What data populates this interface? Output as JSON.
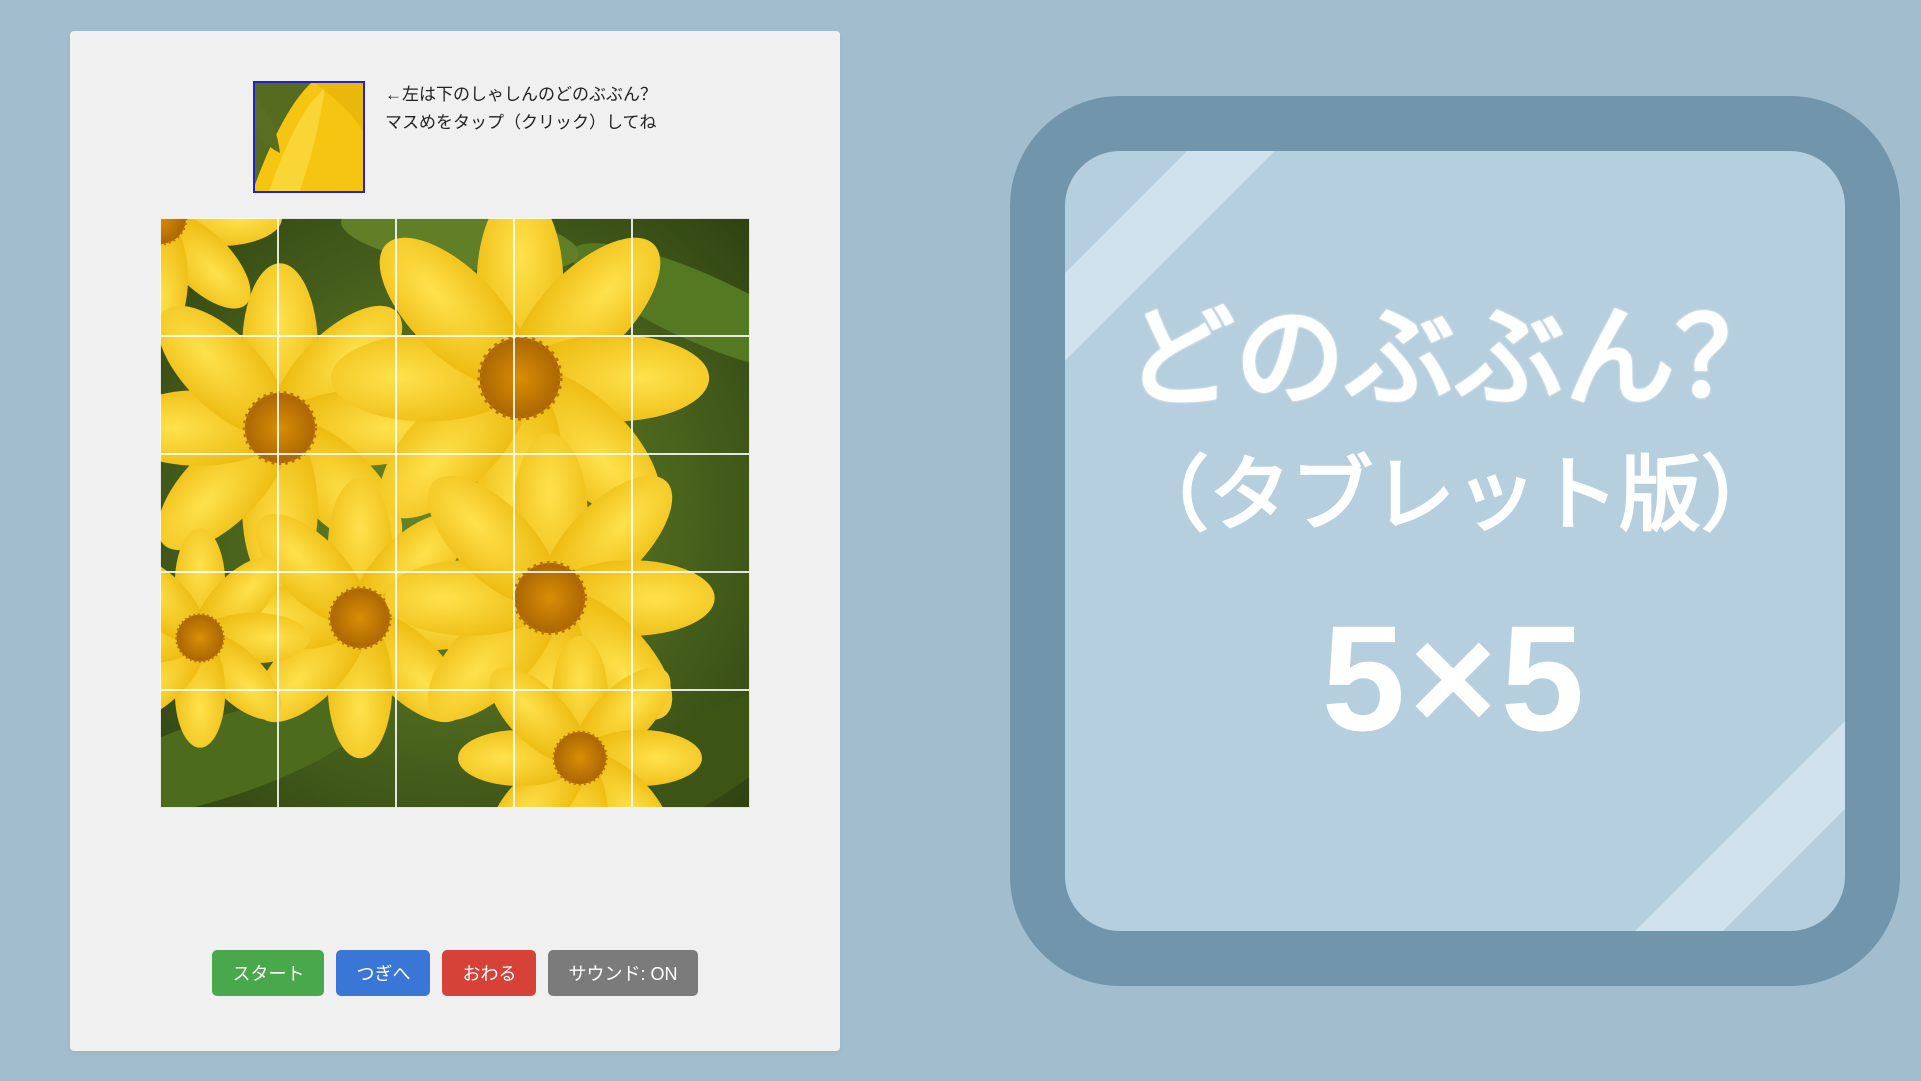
{
  "hint": {
    "line1": "←左は下のしゃしんのどのぶぶん？",
    "line2": "マスめをタップ（クリック）してね"
  },
  "buttons": {
    "start": "スタート",
    "next": "つぎへ",
    "end": "おわる",
    "sound": "サウンド: ON"
  },
  "card": {
    "title": "どのぶぶん？",
    "subtitle": "（タブレット版）",
    "gridsize": "5×5"
  },
  "game": {
    "grid_cols": 5,
    "grid_rows": 5,
    "photo_subject": "yellow-flowers"
  },
  "colors": {
    "bg": "#a2bdce",
    "panel": "#f0f0f0",
    "card_border": "#7195ab",
    "card_fill": "#b5cfde",
    "btn_start": "#49a84c",
    "btn_next": "#3a76d6",
    "btn_end": "#d64237",
    "btn_sound": "#7b7b7b"
  }
}
